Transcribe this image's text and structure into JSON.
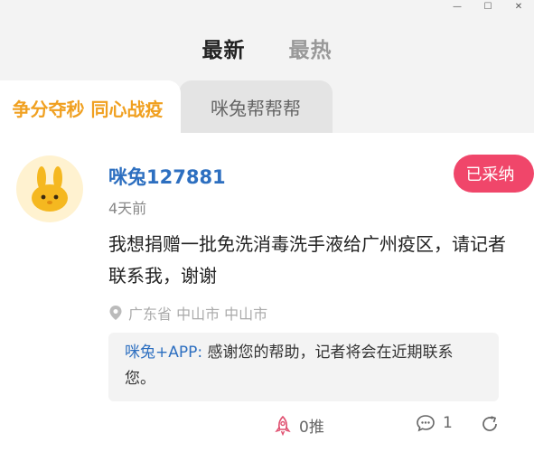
{
  "window": {
    "minimize_icon": "minimize-icon",
    "maximize_icon": "maximize-icon",
    "close_icon": "close-icon",
    "minimize_glyph": "—",
    "maximize_glyph": "☐",
    "close_glyph": "✕"
  },
  "top_tabs": [
    {
      "label": "最新",
      "active": true
    },
    {
      "label": "最热",
      "active": false
    }
  ],
  "category_tabs": [
    {
      "label": "争分夺秒 同心战疫",
      "active": true
    },
    {
      "label": "咪兔帮帮帮",
      "active": false
    }
  ],
  "post": {
    "username": "咪兔127881",
    "time": "4天前",
    "badge": "已采纳",
    "content": "我想捐赠一批免洗消毒洗手液给广州疫区，请记者联系我，谢谢",
    "location": "广东省 中山市 中山市",
    "reply": {
      "author": "咪兔+APP:",
      "text": " 感谢您的帮助，记者将会在近期联系您。"
    },
    "actions": {
      "push_count": "0推",
      "comment_count": "1"
    }
  },
  "colors": {
    "accent_orange": "#f0a020",
    "link_blue": "#2d6fc0",
    "badge_red": "#f0466a"
  }
}
